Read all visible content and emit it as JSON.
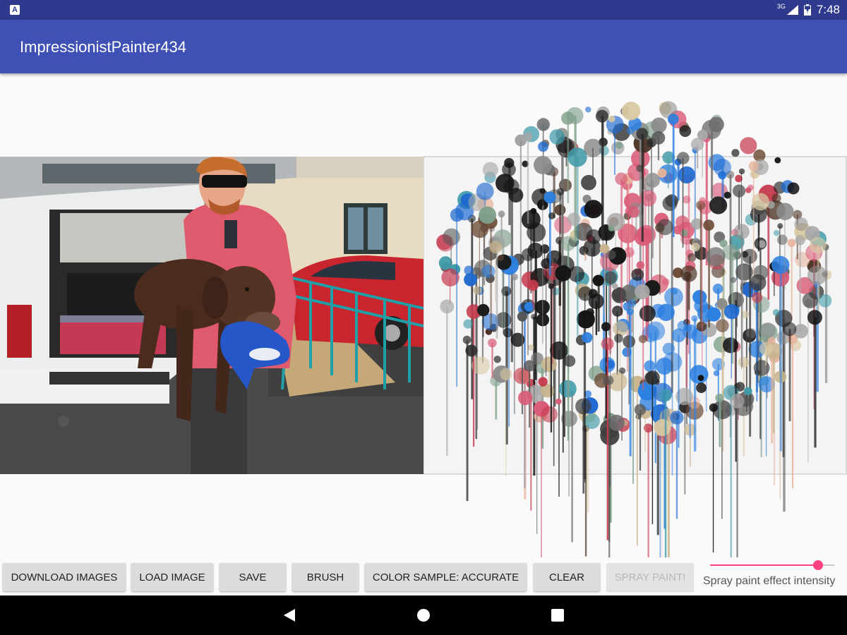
{
  "status_bar": {
    "app_icon": "A",
    "network": "3G",
    "time": "7:48",
    "icons": [
      "signal-icon",
      "battery-icon"
    ]
  },
  "app_bar": {
    "title": "ImpressionistPainter434"
  },
  "toolbar": {
    "download_images": "DOWNLOAD IMAGES",
    "load_image": "LOAD IMAGE",
    "save": "SAVE",
    "brush": "BRUSH",
    "color_sample": "COLOR SAMPLE: ACCURATE",
    "clear": "CLEAR",
    "spray_paint": "SPRAY PAINT!",
    "slider_label": "Spray paint effect intensity",
    "slider_value": 0.87
  },
  "colors": {
    "status_bar": "#2f3a8e",
    "app_bar": "#3f51b5",
    "accent": "#ff4081"
  },
  "nav_icons": [
    "back-icon",
    "home-icon",
    "recents-icon"
  ]
}
